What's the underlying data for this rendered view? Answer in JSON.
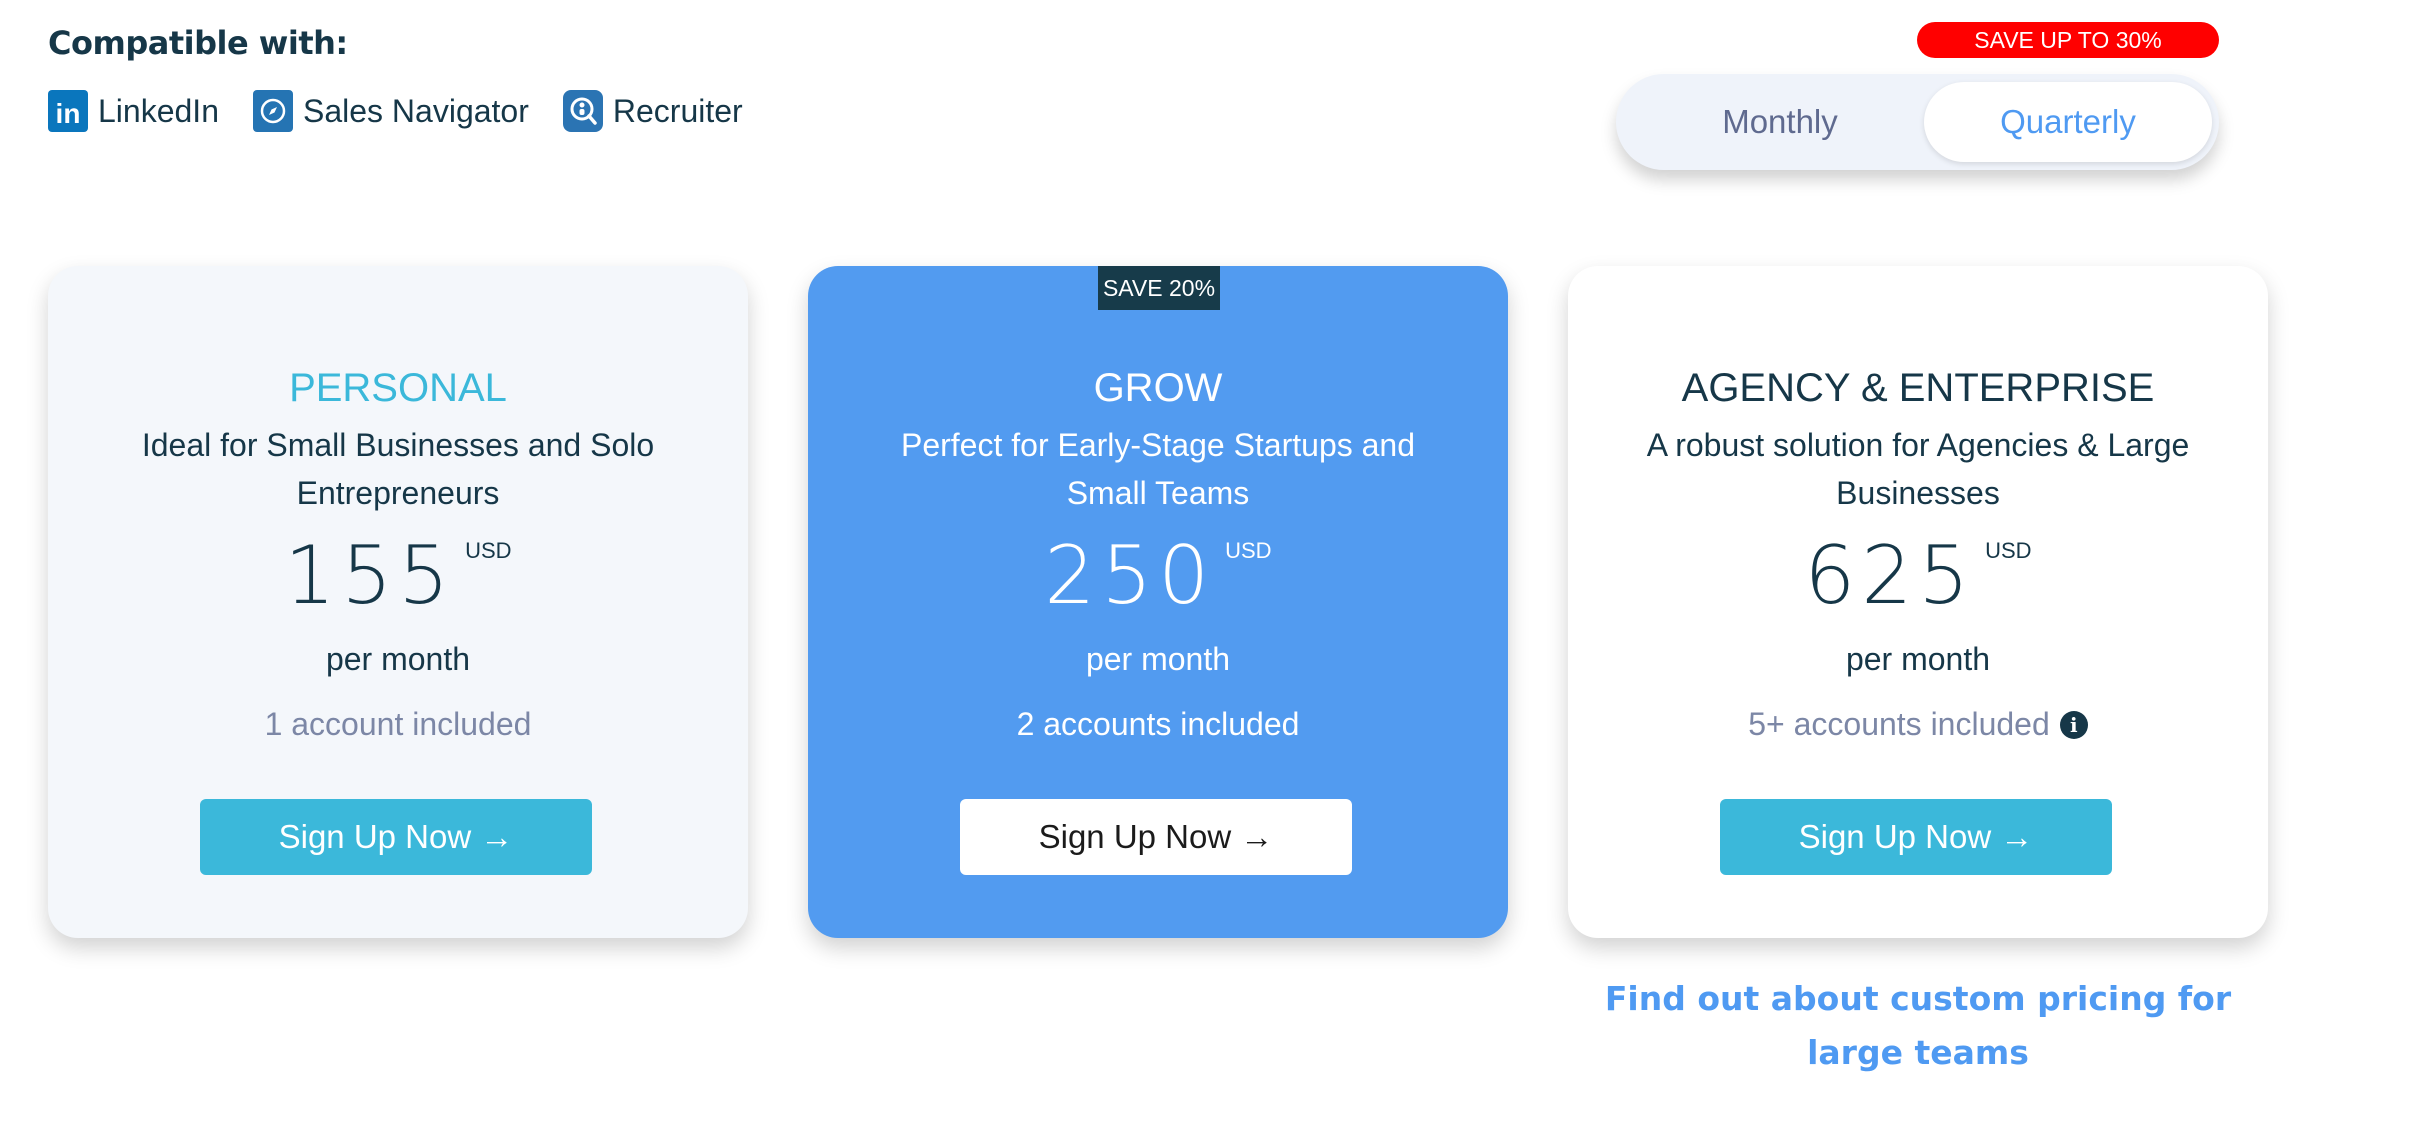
{
  "compatible": {
    "title": "Compatible with:",
    "items": [
      {
        "label": "LinkedIn",
        "icon": "linkedin-icon",
        "glyph": "in"
      },
      {
        "label": "Sales Navigator",
        "icon": "compass-icon"
      },
      {
        "label": "Recruiter",
        "icon": "recruiter-icon"
      }
    ]
  },
  "billing": {
    "save_badge": "SAVE UP TO 30%",
    "options": [
      "Monthly",
      "Quarterly"
    ],
    "selected": "Quarterly"
  },
  "plans": [
    {
      "name": "PERSONAL",
      "description": "Ideal for Small Businesses and Solo Entrepreneurs",
      "price": "155",
      "currency": "USD",
      "period": "per month",
      "accounts": "1 account included",
      "cta": "Sign Up Now →"
    },
    {
      "badge": "SAVE 20%",
      "name": "GROW",
      "description": "Perfect for Early-Stage Startups and Small Teams",
      "price": "250",
      "currency": "USD",
      "period": "per month",
      "accounts": "2 accounts included",
      "cta": "Sign Up Now →"
    },
    {
      "name": "AGENCY & ENTERPRISE",
      "description": "A robust solution for Agencies & Large Businesses",
      "price": "625",
      "currency": "USD",
      "period": "per month",
      "accounts": "5+ accounts included",
      "info_glyph": "i",
      "cta": "Sign Up Now →"
    }
  ],
  "custom_pricing_link": "Find out about custom pricing for large teams",
  "colors": {
    "primary_blue": "#529bf0",
    "teal": "#3bb8da",
    "dark_navy": "#163748",
    "save_red": "#ff0000",
    "link_blue": "#4f9af2"
  }
}
